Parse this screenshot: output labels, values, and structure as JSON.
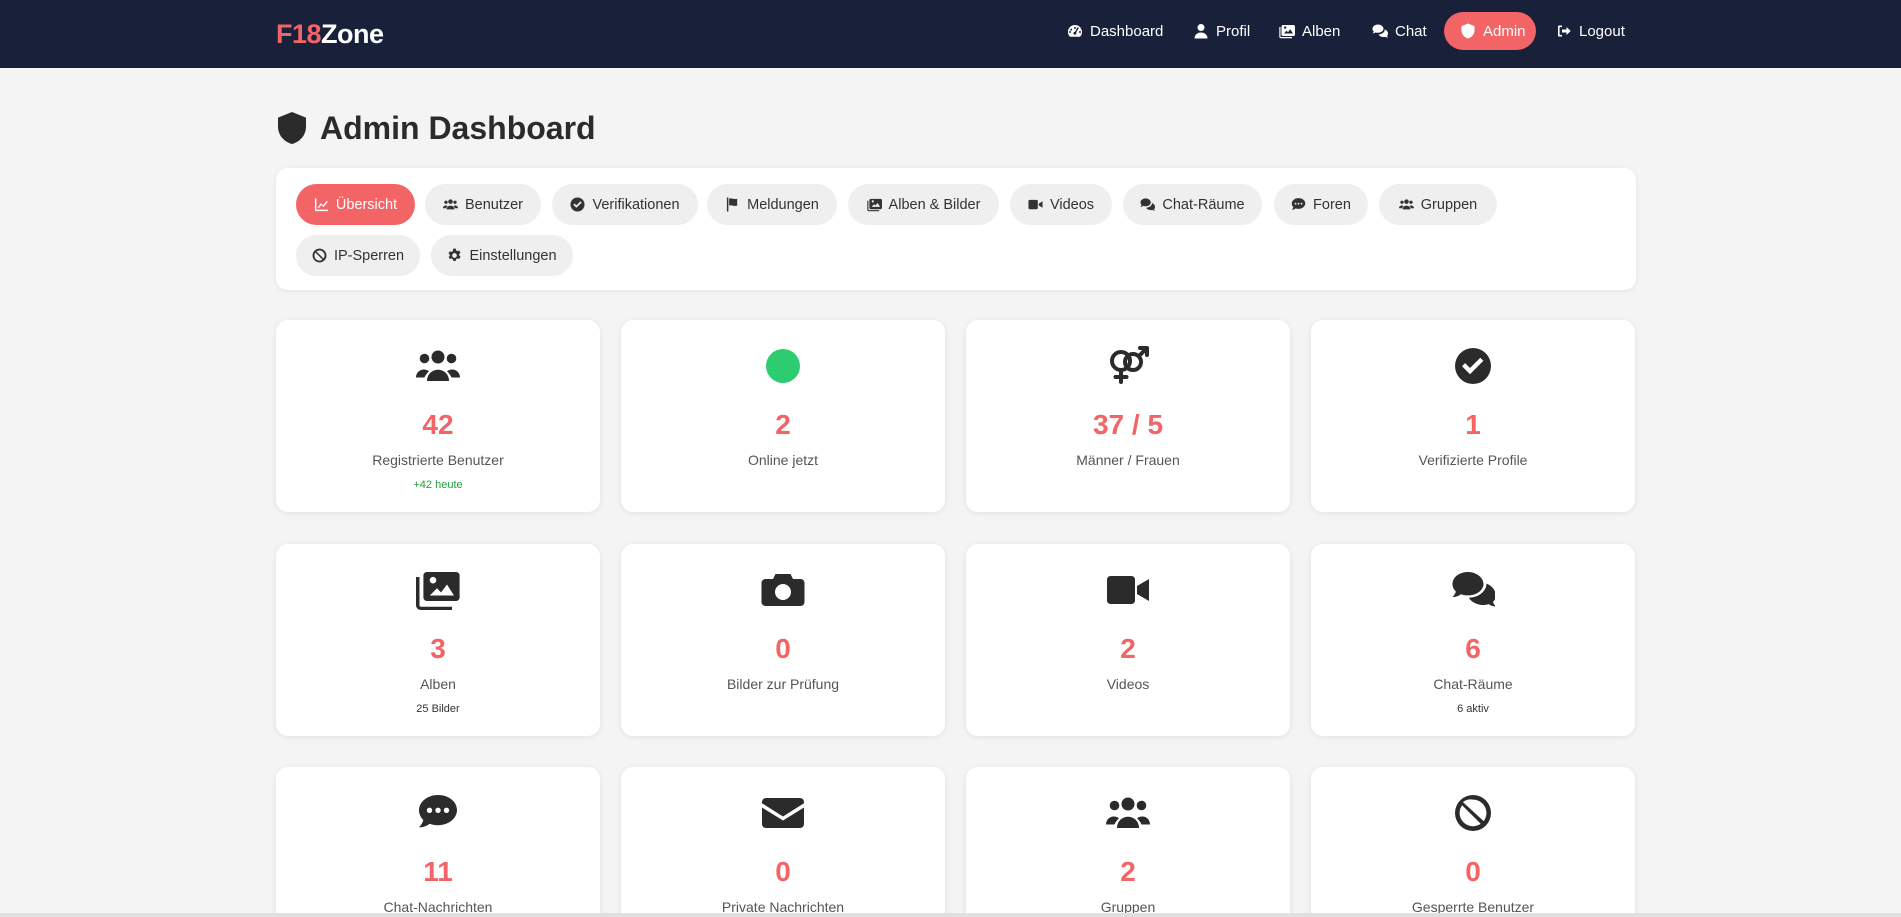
{
  "brand": {
    "part1": "F18",
    "part2": "Zone"
  },
  "nav": {
    "dashboard": "Dashboard",
    "profil": "Profil",
    "alben": "Alben",
    "chat": "Chat",
    "admin": "Admin",
    "logout": "Logout"
  },
  "page": {
    "title": "Admin Dashboard"
  },
  "tabs": [
    {
      "label": "Übersicht",
      "icon": "chart-line-icon",
      "active": true
    },
    {
      "label": "Benutzer",
      "icon": "users-icon"
    },
    {
      "label": "Verifikationen",
      "icon": "check-circle-icon"
    },
    {
      "label": "Meldungen",
      "icon": "flag-icon"
    },
    {
      "label": "Alben & Bilder",
      "icon": "images-icon"
    },
    {
      "label": "Videos",
      "icon": "video-icon"
    },
    {
      "label": "Chat-Räume",
      "icon": "comments-icon"
    },
    {
      "label": "Foren",
      "icon": "comment-dots-icon"
    },
    {
      "label": "Gruppen",
      "icon": "users-icon"
    },
    {
      "label": "IP-Sperren",
      "icon": "ban-icon"
    },
    {
      "label": "Einstellungen",
      "icon": "gear-icon"
    }
  ],
  "stats": [
    {
      "value": "42",
      "label": "Registrierte Benutzer",
      "sub": "+42 heute",
      "icon": "users-icon"
    },
    {
      "value": "2",
      "label": "Online jetzt",
      "icon": "online-dot-icon"
    },
    {
      "value": "37 / 5",
      "label": "Männer / Frauen",
      "icon": "venus-mars-icon"
    },
    {
      "value": "1",
      "label": "Verifizierte Profile",
      "icon": "check-circle-icon"
    },
    {
      "value": "3",
      "label": "Alben",
      "sub": "25 Bilder",
      "icon": "images-icon"
    },
    {
      "value": "0",
      "label": "Bilder zur Prüfung",
      "icon": "camera-icon"
    },
    {
      "value": "2",
      "label": "Videos",
      "icon": "video-icon"
    },
    {
      "value": "6",
      "label": "Chat-Räume",
      "sub": "6 aktiv",
      "icon": "comments-icon"
    },
    {
      "value": "11",
      "label": "Chat-Nachrichten",
      "icon": "comment-dots-icon"
    },
    {
      "value": "0",
      "label": "Private Nachrichten",
      "icon": "envelope-icon"
    },
    {
      "value": "2",
      "label": "Gruppen",
      "icon": "users-icon"
    },
    {
      "value": "0",
      "label": "Gesperrte Benutzer",
      "icon": "ban-icon"
    }
  ],
  "colors": {
    "navbar": "#19203a",
    "accent": "#f26466",
    "online": "#2ecc71",
    "positive": "#1f9d3c",
    "background": "#f4f4f4"
  }
}
